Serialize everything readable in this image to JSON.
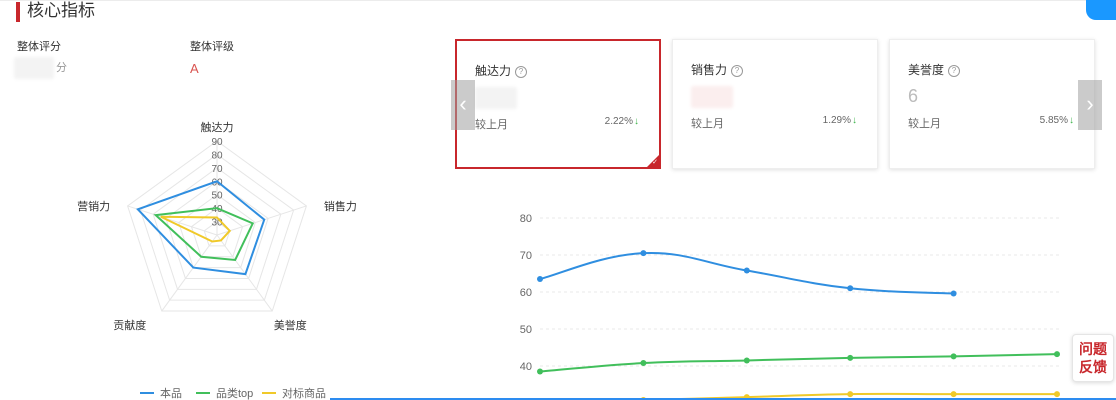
{
  "header": {
    "title": "核心指标"
  },
  "summary": {
    "overall_score_label": "整体评分",
    "overall_score_unit": "分",
    "overall_grade_label": "整体评级",
    "overall_grade_value": "A"
  },
  "cards": [
    {
      "title": "触达力",
      "help": "?",
      "value_hint": "",
      "compare_label": "较上月",
      "change": "2.22%",
      "trend": "down",
      "active": true
    },
    {
      "title": "销售力",
      "help": "?",
      "value_hint": "",
      "compare_label": "较上月",
      "change": "1.29%",
      "trend": "down",
      "active": false
    },
    {
      "title": "美誉度",
      "help": "?",
      "value_hint": "6",
      "compare_label": "较上月",
      "change": "5.85%",
      "trend": "down",
      "active": false
    }
  ],
  "carousel": {
    "prev_icon": "chevron-left-icon",
    "next_icon": "chevron-right-icon",
    "prev_glyph": "‹",
    "next_glyph": "›"
  },
  "feedback": {
    "line1": "问题",
    "line2": "反馈"
  },
  "colors": {
    "accent": "#c8272c",
    "series_blue": "#2f8ee0",
    "series_green": "#41bf5b",
    "series_yellow": "#f0c929"
  },
  "chart_data": [
    {
      "type": "radar",
      "indicators": [
        "触达力",
        "销售力",
        "美誉度",
        "贡献度",
        "营销力"
      ],
      "rlim": [
        20,
        90
      ],
      "tick_labels": [
        "30",
        "40",
        "50",
        "60",
        "70",
        "80",
        "90"
      ],
      "series": [
        {
          "name": "本品",
          "values": [
            60,
            57,
            56,
            50,
            82
          ]
        },
        {
          "name": "品类top",
          "values": [
            40,
            48,
            43,
            40,
            68
          ]
        },
        {
          "name": "对标商品",
          "values": [
            33,
            30,
            25,
            26,
            64
          ]
        }
      ],
      "legend_position": "bottom"
    },
    {
      "type": "line",
      "x": [
        "",
        "",
        "",
        "",
        "",
        ""
      ],
      "ylim": [
        30,
        80
      ],
      "yticks": [
        "80",
        "70",
        "60",
        "50",
        "40"
      ],
      "grid": true,
      "series": [
        {
          "name": "本品",
          "values": [
            63.5,
            70.5,
            65.8,
            61.0,
            59.6,
            null
          ]
        },
        {
          "name": "品类top",
          "values": [
            38.5,
            40.8,
            41.5,
            42.2,
            42.6,
            43.2
          ]
        },
        {
          "name": "对标商品",
          "values": [
            30.2,
            30.8,
            31.6,
            32.4,
            32.4,
            32.4
          ]
        }
      ]
    }
  ]
}
